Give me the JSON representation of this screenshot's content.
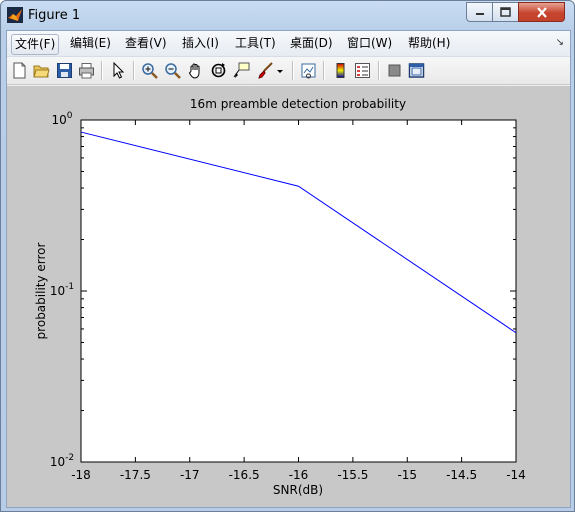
{
  "window": {
    "title": "Figure 1"
  },
  "menu": [
    {
      "label": "文件(F)"
    },
    {
      "label": "编辑(E)"
    },
    {
      "label": "查看(V)"
    },
    {
      "label": "插入(I)"
    },
    {
      "label": "工具(T)"
    },
    {
      "label": "桌面(D)"
    },
    {
      "label": "窗口(W)"
    },
    {
      "label": "帮助(H)"
    }
  ],
  "toolbar": [
    "new-figure-icon",
    "open-file-icon",
    "save-icon",
    "print-icon",
    "edit-plot-icon",
    "zoom-in-icon",
    "zoom-out-icon",
    "pan-icon",
    "rotate-3d-icon",
    "data-cursor-icon",
    "brush-icon",
    "brush-dropdown-icon",
    "link-plot-icon",
    "colorbar-icon",
    "legend-icon",
    "hide-plot-tools-icon",
    "show-plot-tools-icon"
  ],
  "chart_data": {
    "type": "line",
    "title": "16m preamble detection probability",
    "xlabel": "SNR(dB)",
    "ylabel": "probability error",
    "yscale": "log",
    "xlim": [
      -18,
      -14
    ],
    "ylim": [
      0.01,
      1
    ],
    "xticks": [
      "-18",
      "-17.5",
      "-17",
      "-16.5",
      "-16",
      "-15.5",
      "-15",
      "-14.5",
      "-14"
    ],
    "yticks": [
      {
        "base": "10",
        "exp": "0",
        "value": 1
      },
      {
        "base": "10",
        "exp": "-1",
        "value": 0.1
      },
      {
        "base": "10",
        "exp": "-2",
        "value": 0.01
      }
    ],
    "series": [
      {
        "x": [
          -18,
          -16,
          -14
        ],
        "y": [
          0.85,
          0.41,
          0.057
        ],
        "color": "#0000ff"
      }
    ],
    "grid": false
  }
}
